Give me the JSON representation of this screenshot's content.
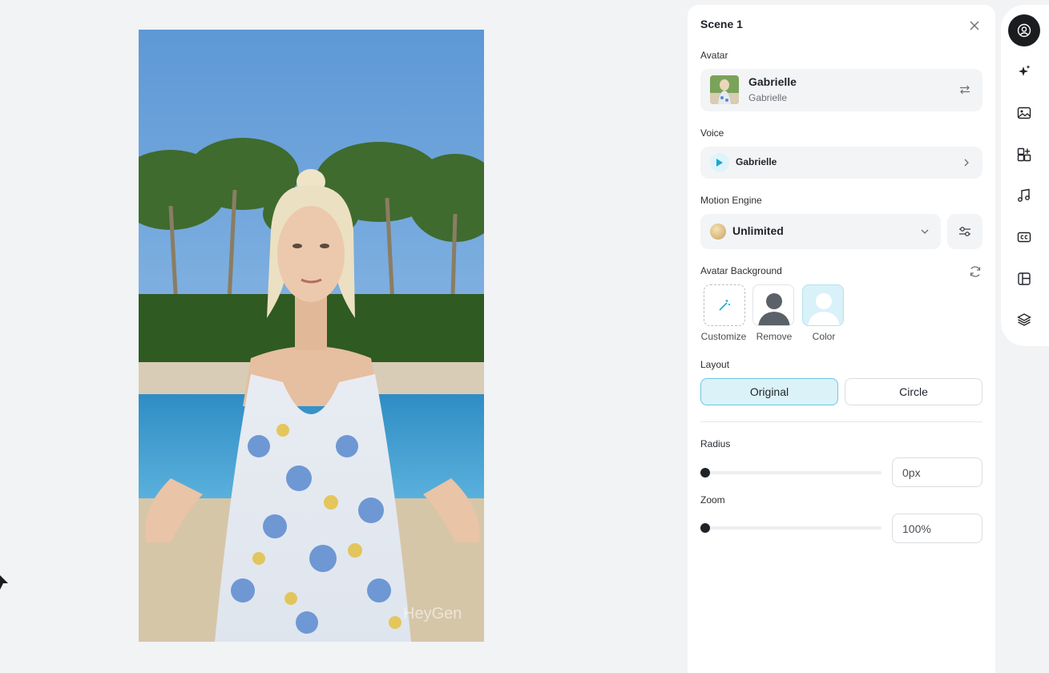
{
  "panel": {
    "title": "Scene 1",
    "avatar_section_label": "Avatar",
    "avatar": {
      "name": "Gabrielle",
      "look": "Gabrielle"
    },
    "voice_section_label": "Voice",
    "voice": {
      "name": "Gabrielle"
    },
    "motion_engine_label": "Motion Engine",
    "motion_engine": {
      "selected": "Unlimited"
    },
    "avatar_background_label": "Avatar Background",
    "background_options": [
      {
        "label": "Customize",
        "icon": "magic-wand-icon"
      },
      {
        "label": "Remove",
        "icon": "person-silhouette-icon"
      },
      {
        "label": "Color",
        "icon": "person-silhouette-icon"
      }
    ],
    "layout_label": "Layout",
    "layout_options": [
      "Original",
      "Circle"
    ],
    "layout_selected": "Original",
    "radius_label": "Radius",
    "radius_value": "0px",
    "zoom_label": "Zoom",
    "zoom_value": "100%"
  },
  "slider_levels": {
    "radius": 0,
    "zoom": 0
  },
  "rail": {
    "items": [
      {
        "icon": "avatar-icon",
        "active": true
      },
      {
        "icon": "sparkle-icon",
        "active": false
      },
      {
        "icon": "image-icon",
        "active": false
      },
      {
        "icon": "elements-icon",
        "active": false
      },
      {
        "icon": "music-icon",
        "active": false
      },
      {
        "icon": "captions-icon",
        "active": false
      },
      {
        "icon": "layout-icon",
        "active": false
      },
      {
        "icon": "layers-icon",
        "active": false
      }
    ]
  },
  "colors": {
    "accent": "#6cc7e0",
    "accent_bg": "#dbf2f9",
    "rail_active": "#1a1c1f",
    "voice_play": "#19a9d1"
  }
}
